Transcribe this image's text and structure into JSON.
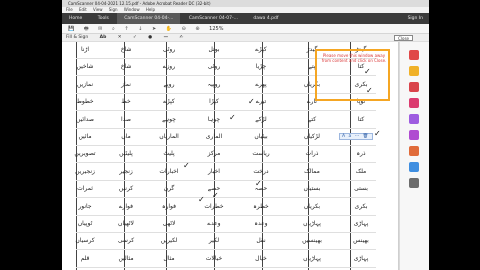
{
  "window": {
    "title": "CamScanner 04-04-2021 12.15.pdf - Adobe Acrobat Reader DC (32-bit)"
  },
  "menu": [
    "File",
    "Edit",
    "View",
    "Sign",
    "Window",
    "Help"
  ],
  "tabs": [
    {
      "label": "Home"
    },
    {
      "label": "Tools"
    },
    {
      "label": "CamScanner 04-04-..."
    },
    {
      "label": "CamScanner 04-07-..."
    },
    {
      "label": "dawa 4.pdf"
    }
  ],
  "sign_in": "Sign In",
  "toolbar": {
    "zoom": "125%"
  },
  "fill_sign": {
    "title": "Fill & Sign",
    "tool_text": "Ab",
    "close_label": "Close"
  },
  "annotation": {
    "note": "Please move this window away from content and click on Close."
  },
  "checkmark_glyph": "✓",
  "float_toolbar": [
    "A",
    "a",
    "⋯",
    "🗑"
  ],
  "rightpanel_icons": [
    {
      "name": "pdf-icon",
      "color": "#e04848"
    },
    {
      "name": "comment-icon",
      "color": "#f0b128"
    },
    {
      "name": "edit-icon",
      "color": "#d9444b"
    },
    {
      "name": "export-icon",
      "color": "#db3b6f"
    },
    {
      "name": "organize-icon",
      "color": "#9e5ce0"
    },
    {
      "name": "fill-sign-icon",
      "color": "#b04bd1"
    },
    {
      "name": "send-icon",
      "color": "#e06b3a"
    },
    {
      "name": "scan-icon",
      "color": "#3f8ee0"
    },
    {
      "name": "protect-icon",
      "color": "#6c6c6c"
    }
  ],
  "document": {
    "rows": [
      [
        "گیدڑ",
        "گیدڑ",
        "کپڑے",
        "بوتل",
        "روٹی",
        "شاخ",
        "اڑنا"
      ],
      [
        "کتا",
        "پتے",
        "چڑیا",
        "روٹی",
        "روزے",
        "شاخ",
        "شاخیں"
      ],
      [
        "بکری",
        "بکریاں",
        "پھرے",
        "روپیہ",
        "روپے",
        "نماز",
        "نمازیں"
      ],
      [
        "ٹوپا",
        "تارے",
        "تیرے",
        "کپڑا",
        "کپڑے",
        "خط",
        "خطوط"
      ],
      [
        "کتا",
        "کتے",
        "لڑکے",
        "چوہا",
        "چوہے",
        "صدا",
        "صدائیں"
      ],
      [
        "لڑکی",
        "لڑکیاں",
        "بیٹیاں",
        "الماری",
        "الماریاں",
        "ماں",
        "مائیں"
      ],
      [
        "ذرہ",
        "ذرات",
        "ریاست",
        "مرکز",
        "پلیٹ",
        "پلیٹیں",
        "تصویریں"
      ],
      [
        "ملک",
        "ممالک",
        "درخت",
        "اخبار",
        "اخبارات",
        "زنجیر",
        "زنجیریں"
      ],
      [
        "بستی",
        "بستیاں",
        "حصہ",
        "حصے",
        "گرن",
        "کرنیں",
        "ثمرات"
      ],
      [
        "بکری",
        "بکریاں",
        "خطرہ",
        "خطرات",
        "فوارہ",
        "فوارے",
        "جانور"
      ],
      [
        "پہاڑی",
        "پہاڑیاں",
        "وعدہ",
        "وعدے",
        "لاٹھی",
        "لاٹھیاں",
        "ٹوپیاں"
      ],
      [
        "بھینس",
        "بھینسیں",
        "نقل",
        "لکیر",
        "لکیریں",
        "کرسی",
        "کرسیاں"
      ],
      [
        "پہاڑی",
        "پہاڑیاں",
        "خیال",
        "خیالات",
        "مثال",
        "مثالیں",
        "قلم"
      ]
    ]
  }
}
